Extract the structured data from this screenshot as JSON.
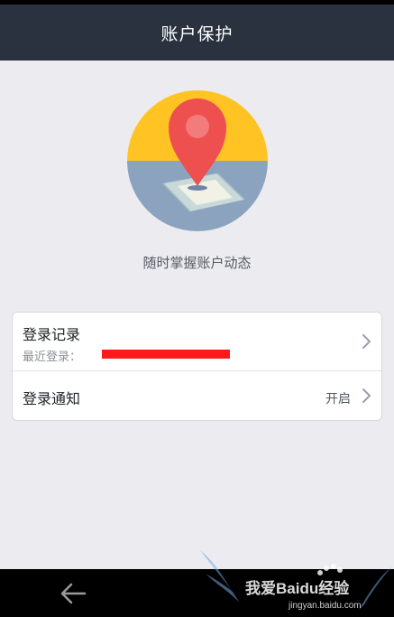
{
  "header": {
    "title": "账户保护"
  },
  "hero": {
    "tagline": "随时掌握账户动态",
    "illustration": "location-pin-icon"
  },
  "settings": {
    "items": [
      {
        "label": "登录记录",
        "sub_label": "最近登录：",
        "value": "",
        "icon": "chevron-right-icon"
      },
      {
        "label": "登录通知",
        "value": "开启",
        "icon": "chevron-right-icon"
      }
    ]
  },
  "navbar": {
    "back_icon": "back-arrow-icon"
  },
  "watermark": {
    "text": "我爱Baidu经验",
    "url": "jingyan.baidu.com"
  },
  "colors": {
    "header_bg": "#2a313f",
    "page_bg": "#ececf0",
    "circle_top": "#ffc423",
    "circle_bottom": "#8ca3bf",
    "pin": "#ee4f4f",
    "redaction": "#ff1a1a"
  }
}
